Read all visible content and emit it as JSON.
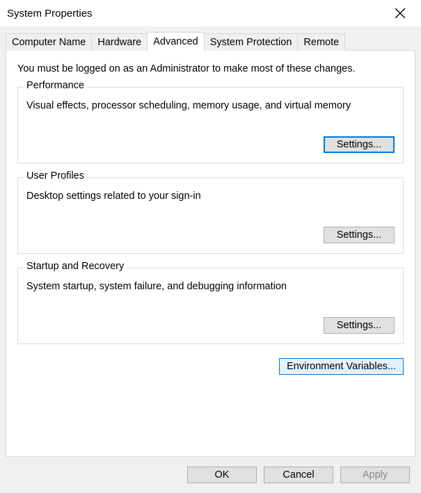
{
  "window": {
    "title": "System Properties"
  },
  "tabs": {
    "computer_name": "Computer Name",
    "hardware": "Hardware",
    "advanced": "Advanced",
    "system_protection": "System Protection",
    "remote": "Remote"
  },
  "advanced_panel": {
    "admin_note": "You must be logged on as an Administrator to make most of these changes.",
    "performance": {
      "legend": "Performance",
      "desc": "Visual effects, processor scheduling, memory usage, and virtual memory",
      "settings_label": "Settings..."
    },
    "user_profiles": {
      "legend": "User Profiles",
      "desc": "Desktop settings related to your sign-in",
      "settings_label": "Settings..."
    },
    "startup_recovery": {
      "legend": "Startup and Recovery",
      "desc": "System startup, system failure, and debugging information",
      "settings_label": "Settings..."
    },
    "env_vars_label": "Environment Variables..."
  },
  "dialog_buttons": {
    "ok": "OK",
    "cancel": "Cancel",
    "apply": "Apply"
  }
}
